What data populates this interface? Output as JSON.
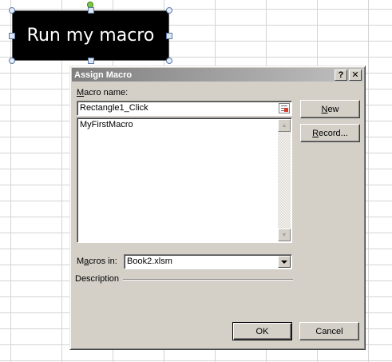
{
  "sheet": {
    "shape_text": "Run my macro"
  },
  "dialog": {
    "title": "Assign Macro",
    "help_button": "?",
    "close_button": "✕",
    "macro_name_label_u": "M",
    "macro_name_label_rest": "acro name:",
    "macro_name_value": "Rectangle1_Click",
    "macro_list": [
      "MyFirstMacro"
    ],
    "new_button_u": "N",
    "new_button_rest": "ew",
    "record_button_u": "R",
    "record_button_rest": "ecord...",
    "macros_in_label_pre": "M",
    "macros_in_label_u": "a",
    "macros_in_label_rest": "cros in:",
    "macros_in_value": "Book2.xlsm",
    "description_label": "Description",
    "ok_button": "OK",
    "cancel_button": "Cancel"
  },
  "icons": {
    "scroll_up": "scroll-up-arrow-icon",
    "scroll_down": "scroll-down-arrow-icon",
    "ref_edit": "ref-edit-icon",
    "dropdown": "chevron-down-icon"
  }
}
